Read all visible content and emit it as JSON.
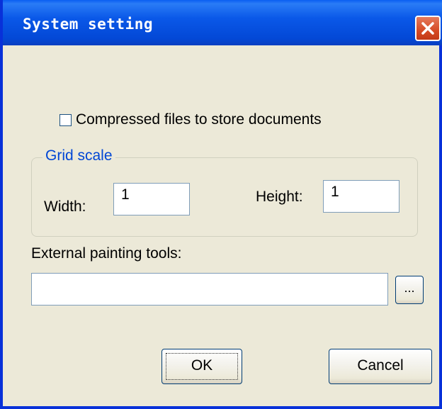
{
  "window": {
    "title": "System setting",
    "close_icon": "close-x-icon"
  },
  "options": {
    "compress_label": "Compressed files to store documents",
    "compress_checked": false
  },
  "grid_scale": {
    "title": "Grid scale",
    "width_label": "Width:",
    "width_value": "1",
    "height_label": "Height:",
    "height_value": "1"
  },
  "external_tools": {
    "label": "External painting tools:",
    "path_value": "",
    "browse_label": "..."
  },
  "buttons": {
    "ok_label": "OK",
    "cancel_label": "Cancel"
  },
  "colors": {
    "titlebar": "#0a58e8",
    "dialog_bg": "#ece9d8",
    "group_title": "#0046d5",
    "close_button": "#d64b25"
  }
}
